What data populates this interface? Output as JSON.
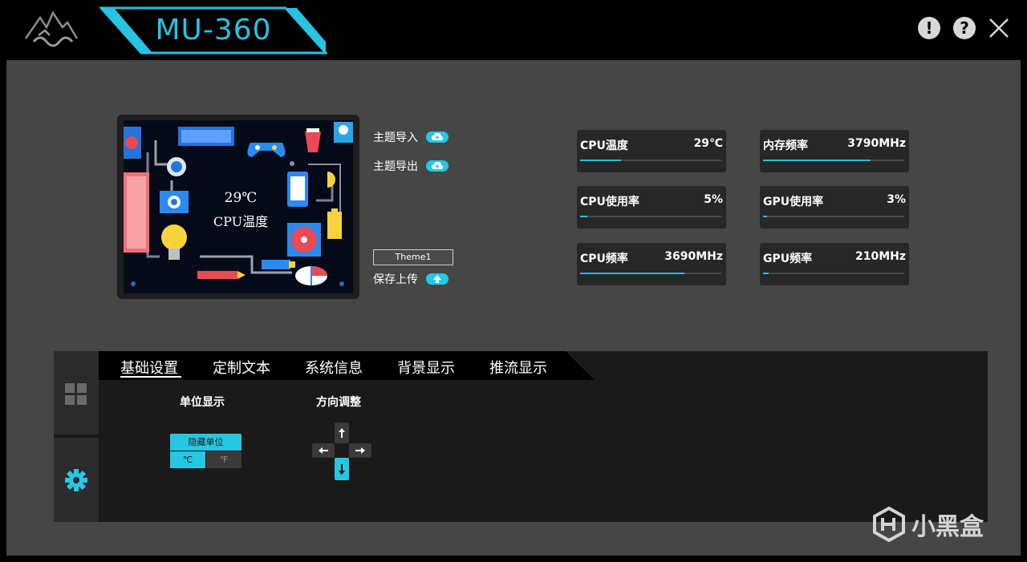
{
  "app": {
    "title": "MU-360"
  },
  "header": {
    "info_symbol": "!",
    "help_symbol": "?",
    "icons": {
      "logo": "mountain-logo-icon",
      "info": "info-icon",
      "help": "help-icon",
      "close": "close-icon"
    }
  },
  "preview": {
    "value": "29℃",
    "label": "CPU温度"
  },
  "theme": {
    "import_label": "主题导入",
    "export_label": "主题导出",
    "name": "Theme1",
    "save_label": "保存上传"
  },
  "stats": [
    {
      "label": "CPU温度",
      "value": "29℃",
      "fraction": 0.29
    },
    {
      "label": "内存频率",
      "value": "3790MHz",
      "fraction": 0.76
    },
    {
      "label": "CPU使用率",
      "value": "5%",
      "fraction": 0.05
    },
    {
      "label": "GPU使用率",
      "value": "3%",
      "fraction": 0.03
    },
    {
      "label": "CPU频率",
      "value": "3690MHz",
      "fraction": 0.74
    },
    {
      "label": "GPU频率",
      "value": "210MHz",
      "fraction": 0.04
    }
  ],
  "tabs": [
    "基础设置",
    "定制文本",
    "系统信息",
    "背景显示",
    "推流显示"
  ],
  "active_tab": 0,
  "settings": {
    "unit_title": "单位显示",
    "hide_unit": "隐藏单位",
    "celsius": "℃",
    "fahrenheit": "℉",
    "direction_title": "方向调整",
    "active_direction": "down"
  },
  "watermark": {
    "text": "小黑盒",
    "icon": "heybox-logo-icon"
  },
  "colors": {
    "accent": "#25c8e2",
    "panel": "#464646",
    "card": "#272727",
    "background": "#000000"
  }
}
